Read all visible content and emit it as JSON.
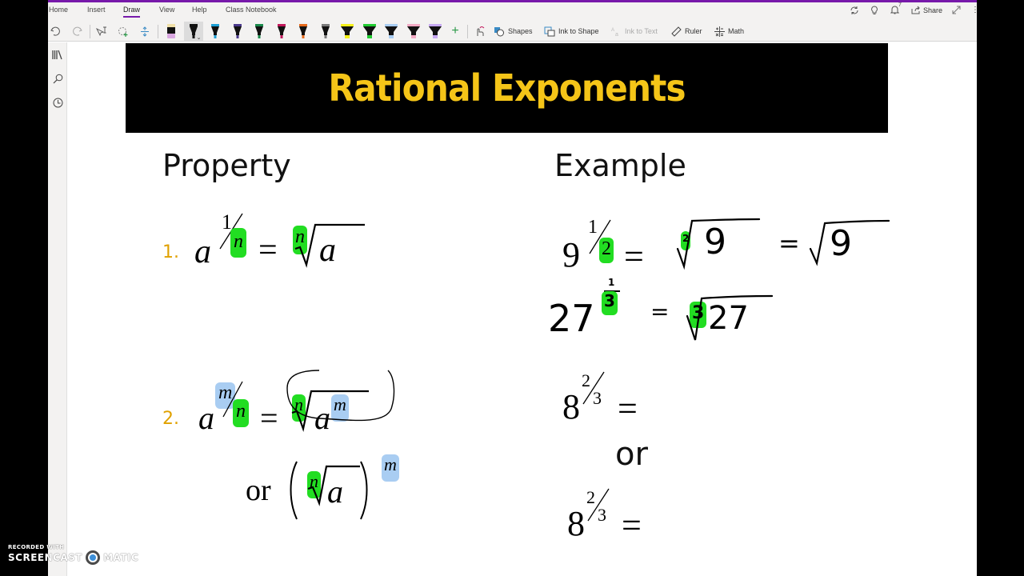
{
  "ribbon": {
    "tabs": [
      {
        "label": "Home",
        "active": false
      },
      {
        "label": "Insert",
        "active": false
      },
      {
        "label": "Draw",
        "active": true
      },
      {
        "label": "View",
        "active": false
      },
      {
        "label": "Help",
        "active": false
      },
      {
        "label": "Class Notebook",
        "active": false
      }
    ],
    "right": {
      "sync_icon": "sync-icon",
      "tips_icon": "lightbulb-icon",
      "notifications_count": "7",
      "share_label": "Share",
      "expand_icon": "expand-icon",
      "more_icon": "more-icon"
    },
    "tools": {
      "undo": "undo-icon",
      "redo": "redo-icon",
      "type_select": "type-select-icon",
      "lasso": "lasso-select-icon",
      "add_space": "add-space-icon",
      "pens": [
        {
          "name": "eraser",
          "color": "#d9a7e0"
        },
        {
          "name": "black-pen",
          "color": "#111111",
          "selected": true
        },
        {
          "name": "blue-pen",
          "color": "#1ea0d6"
        },
        {
          "name": "purple-pen",
          "color": "#4b3a8c"
        },
        {
          "name": "green-pen",
          "color": "#1b8a4c"
        },
        {
          "name": "magenta-pen",
          "color": "#c2185b"
        },
        {
          "name": "orange-pen",
          "color": "#e66a1c"
        },
        {
          "name": "gray-pen",
          "color": "#7a7a7a"
        },
        {
          "name": "yellow-highlighter",
          "color": "#f5f01a"
        },
        {
          "name": "green-highlighter",
          "color": "#22cc33"
        },
        {
          "name": "lightblue-highlighter",
          "color": "#a9cdf2"
        },
        {
          "name": "pink-highlighter",
          "color": "#f2a9c4"
        },
        {
          "name": "lavender-highlighter",
          "color": "#c7a9f2"
        }
      ],
      "add_pen": "+",
      "ink_replay": "ink-replay-icon",
      "shapes_label": "Shapes",
      "ink_to_shape_label": "Ink to Shape",
      "ink_to_text_label": "Ink to Text",
      "ruler_label": "Ruler",
      "math_label": "Math"
    }
  },
  "sidebar": {
    "items": [
      "notebooks-icon",
      "search-icon",
      "recent-icon"
    ]
  },
  "page": {
    "title": "Rational Exponents",
    "colors": {
      "title": "#f5c518",
      "banner_bg": "#000000",
      "number": "#e0a100",
      "green_highlight": "#22dd22",
      "blue_highlight": "#a9cdf2"
    },
    "property_heading": "Property",
    "example_heading": "Example",
    "properties": [
      {
        "number": "1.",
        "base": "a",
        "exp_num": "1",
        "exp_den": "n",
        "equals": "=",
        "root_index": "n",
        "radicand": "a"
      },
      {
        "number": "2.",
        "base": "a",
        "exp_num": "m",
        "exp_den": "n",
        "equals": "=",
        "root_index": "n",
        "radicand": "a",
        "radicand_exp": "m",
        "or": "or",
        "alt_root_index": "n",
        "alt_radicand": "a",
        "alt_exp": "m"
      }
    ],
    "examples": [
      {
        "base": "9",
        "exp_num": "1",
        "exp_den": "2",
        "equals": "=",
        "root_index": "2",
        "radicand": "9",
        "equals2": "=",
        "simplified_radicand": "9"
      },
      {
        "base": "27",
        "exp_num": "1",
        "exp_den": "3",
        "equals": "=",
        "root_index": "3",
        "radicand": "27"
      },
      {
        "base": "8",
        "exp_num": "2",
        "exp_den": "3",
        "equals": "="
      },
      {
        "or": "or"
      },
      {
        "base": "8",
        "exp_num": "2",
        "exp_den": "3",
        "equals": "="
      }
    ]
  },
  "watermark": {
    "line1": "RECORDED WITH",
    "line2a": "SCREENCAST",
    "line2b": "MATIC"
  }
}
